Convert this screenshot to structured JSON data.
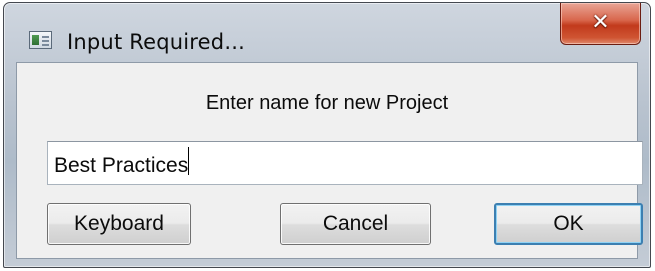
{
  "window": {
    "title": "Input Required...",
    "icon": "application-window-icon",
    "close_glyph": "✕",
    "accent_color": "#c23a1c"
  },
  "dialog": {
    "prompt": "Enter name for new Project",
    "input": {
      "value": "Best Practices",
      "placeholder": ""
    },
    "buttons": {
      "keyboard_label": "Keyboard",
      "cancel_label": "Cancel",
      "ok_label": "OK"
    }
  }
}
